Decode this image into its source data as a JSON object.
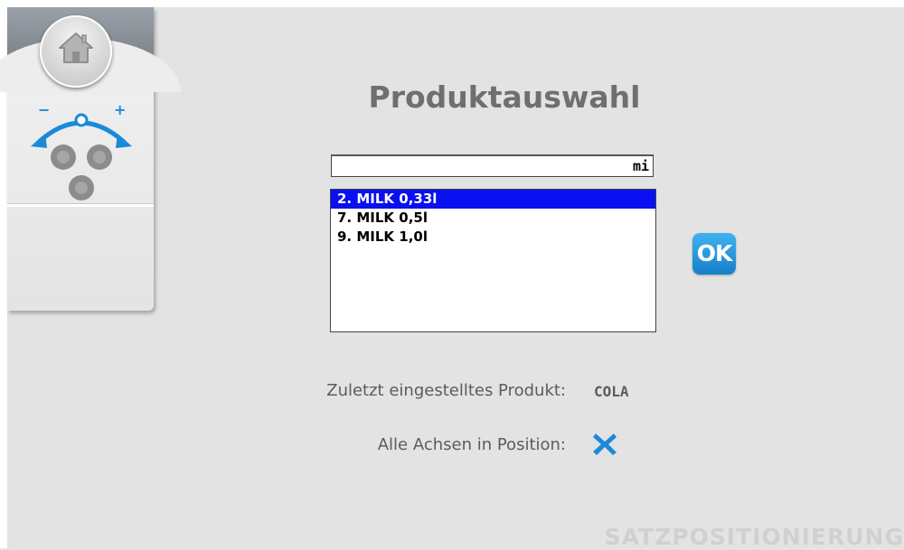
{
  "sidebar": {
    "home_icon": "home-icon",
    "position_icon": "axis-adjust-icon",
    "minus_label": "−",
    "plus_label": "+"
  },
  "main": {
    "title": "Produktauswahl",
    "search": {
      "value": "mi"
    },
    "products": [
      {
        "label": "2. MILK 0,33l",
        "selected": true
      },
      {
        "label": "7. MILK 0,5l",
        "selected": false
      },
      {
        "label": "9. MILK 1,0l",
        "selected": false
      }
    ],
    "ok_label": "OK",
    "last_product": {
      "label": "Zuletzt eingestelltes Produkt:",
      "value": "COLA"
    },
    "axes": {
      "label": "Alle Achsen in Position:",
      "status_icon": "x-icon"
    }
  },
  "footer": {
    "label": "SATZPOSITIONIERUNG"
  },
  "colors": {
    "accent": "#1a8ad8",
    "selection": "#0a10f0",
    "title": "#6f6f6f"
  }
}
